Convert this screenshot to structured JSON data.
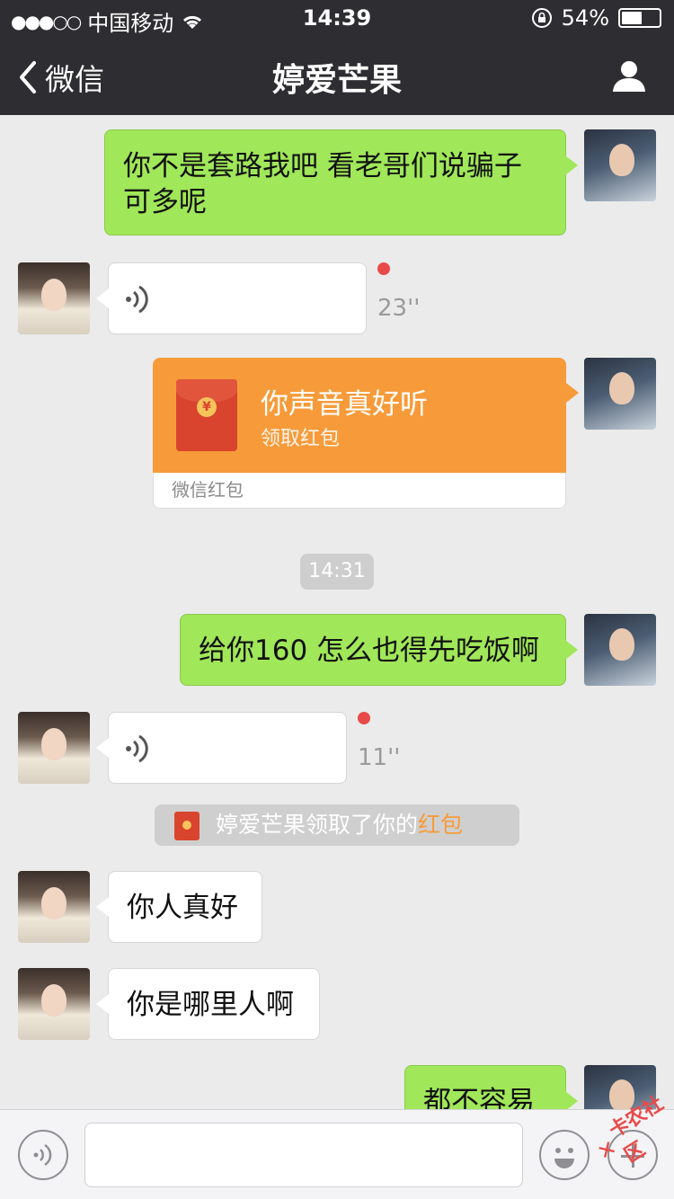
{
  "status_bar": {
    "carrier": "中国移动",
    "time": "14:39",
    "battery": "54%",
    "battery_level": 0.54
  },
  "nav": {
    "back_label": "微信",
    "title": "婷爱芒果"
  },
  "messages": [
    {
      "from": "me",
      "type": "text",
      "text_line1": "你不是套路我吧  看老哥们说骗子",
      "text_line2": "可多呢"
    },
    {
      "from": "her",
      "type": "voice",
      "duration": "23''"
    },
    {
      "from": "me",
      "type": "red_packet",
      "title": "你声音真好听",
      "action": "领取红包",
      "footer": "微信红包"
    },
    {
      "type": "timestamp",
      "text": "14:31"
    },
    {
      "from": "me",
      "type": "text",
      "text": "给你160 怎么也得先吃饭啊"
    },
    {
      "from": "her",
      "type": "voice",
      "duration": "11''"
    },
    {
      "type": "system",
      "text": "婷爱芒果领取了你的",
      "link": "红包"
    },
    {
      "from": "her",
      "type": "text",
      "text": "你人真好"
    },
    {
      "from": "her",
      "type": "text",
      "text": "你是哪里人啊"
    },
    {
      "from": "me",
      "type": "text",
      "text": "都不容易"
    }
  ],
  "watermark": "卡农社区",
  "colors": {
    "nav_bg": "#2e2e32",
    "chat_bg": "#ebebeb",
    "my_bubble": "#a0e759",
    "her_bubble": "#ffffff",
    "red_packet": "#f79b3a",
    "unread_dot": "#e84a4a"
  },
  "icons": [
    "back-chevron-icon",
    "person-icon",
    "wifi-icon",
    "rotation-lock-icon",
    "voice-icon",
    "emoji-icon",
    "plus-icon",
    "red-packet-icon"
  ]
}
